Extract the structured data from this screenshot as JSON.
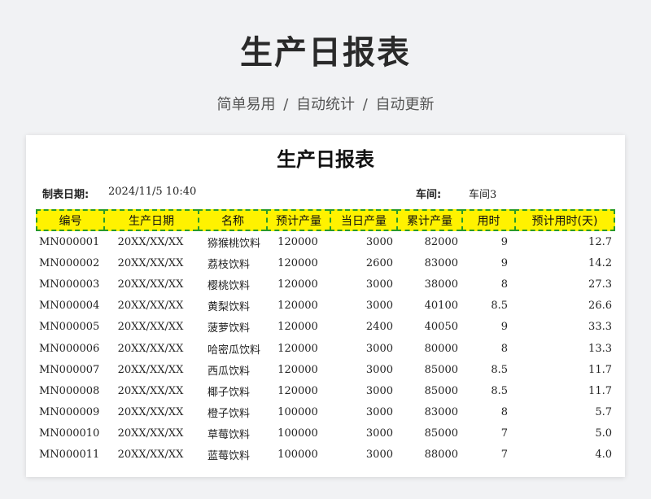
{
  "banner": {
    "title": "生产日报表",
    "subtitle": "简单易用 / 自动统计 / 自动更新"
  },
  "sheet": {
    "title": "生产日报表",
    "date_label": "制表日期:",
    "date_value": "2024/11/5 10:40",
    "workshop_label": "车间:",
    "workshop_value": "车间3"
  },
  "table": {
    "headers": [
      "编号",
      "生产日期",
      "名称",
      "预计产量",
      "当日产量",
      "累计产量",
      "用时",
      "预计用时(天)"
    ],
    "rows": [
      [
        "MN000001",
        "20XX/XX/XX",
        "猕猴桃饮料",
        "120000",
        "3000",
        "82000",
        "9",
        "12.7"
      ],
      [
        "MN000002",
        "20XX/XX/XX",
        "荔枝饮料",
        "120000",
        "2600",
        "83000",
        "9",
        "14.2"
      ],
      [
        "MN000003",
        "20XX/XX/XX",
        "樱桃饮料",
        "120000",
        "3000",
        "38000",
        "8",
        "27.3"
      ],
      [
        "MN000004",
        "20XX/XX/XX",
        "黄梨饮料",
        "120000",
        "3000",
        "40100",
        "8.5",
        "26.6"
      ],
      [
        "MN000005",
        "20XX/XX/XX",
        "菠萝饮料",
        "120000",
        "2400",
        "40050",
        "9",
        "33.3"
      ],
      [
        "MN000006",
        "20XX/XX/XX",
        "哈密瓜饮料",
        "120000",
        "3000",
        "80000",
        "8",
        "13.3"
      ],
      [
        "MN000007",
        "20XX/XX/XX",
        "西瓜饮料",
        "120000",
        "3000",
        "85000",
        "8.5",
        "11.7"
      ],
      [
        "MN000008",
        "20XX/XX/XX",
        "椰子饮料",
        "120000",
        "3000",
        "85000",
        "8.5",
        "11.7"
      ],
      [
        "MN000009",
        "20XX/XX/XX",
        "橙子饮料",
        "100000",
        "3000",
        "83000",
        "8",
        "5.7"
      ],
      [
        "MN000010",
        "20XX/XX/XX",
        "草莓饮料",
        "100000",
        "3000",
        "85000",
        "7",
        "5.0"
      ],
      [
        "MN000011",
        "20XX/XX/XX",
        "蓝莓饮料",
        "100000",
        "3000",
        "88000",
        "7",
        "4.0"
      ]
    ]
  },
  "colors": {
    "header_fill": "#fff200",
    "header_border": "#2a9a2a",
    "page_background": "#f1f2f4"
  }
}
